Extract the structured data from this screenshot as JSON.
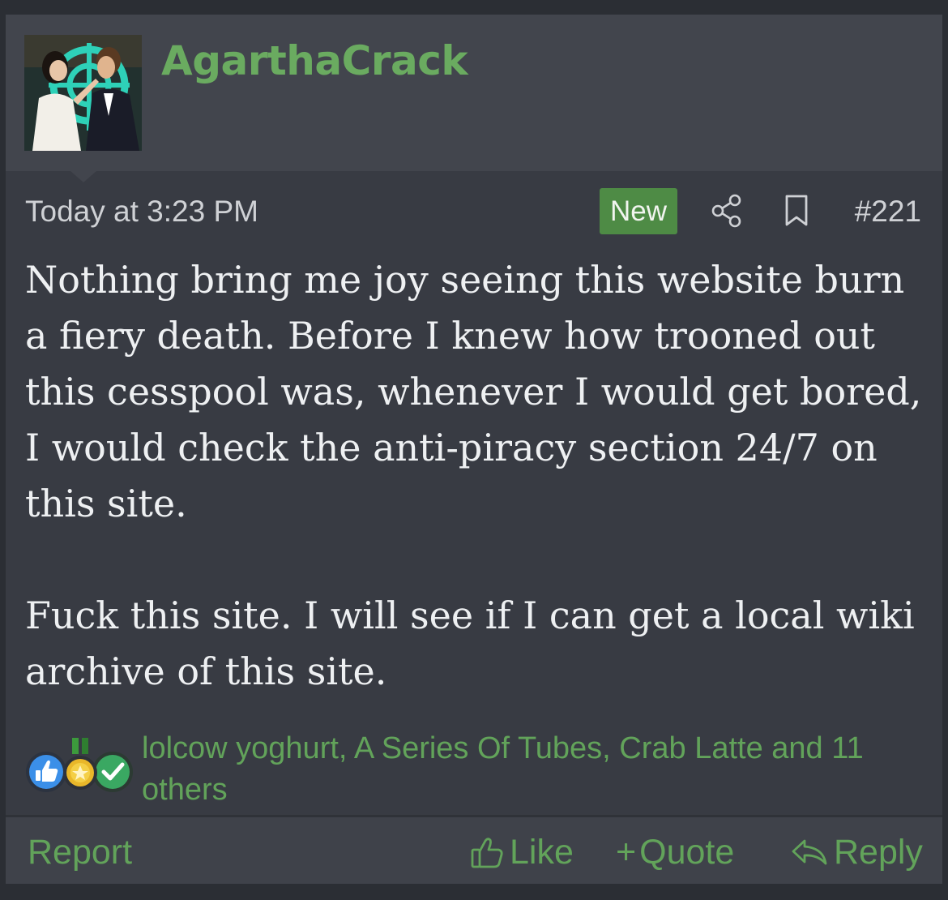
{
  "post": {
    "author": "AgarthaCrack",
    "timestamp": "Today at 3:23 PM",
    "badge": "New",
    "post_number": "#221",
    "body": [
      "Nothing bring me joy seeing this website burn a fiery death. Before I knew how trooned out this cesspool was, whenever I would get bored, I would check the anti-piracy section 24/7 on this site.",
      "Fuck this site. I will see if I can get a local wiki archive of this site."
    ],
    "reactions": {
      "icons": [
        "thumbs-up-icon",
        "medal-icon",
        "checkmark-icon"
      ],
      "summary": "lolcow yoghurt, A Series Of Tubes, Crab Latte and 11 others"
    }
  },
  "footer": {
    "report": "Report",
    "like": "Like",
    "quote_plus": "+",
    "quote": "Quote",
    "reply": "Reply"
  },
  "colors": {
    "accent_green": "#62a35a",
    "username_green": "#6aab60",
    "badge_green": "#4e8b45",
    "post_bg": "#383b43",
    "header_bg": "#42454d"
  }
}
